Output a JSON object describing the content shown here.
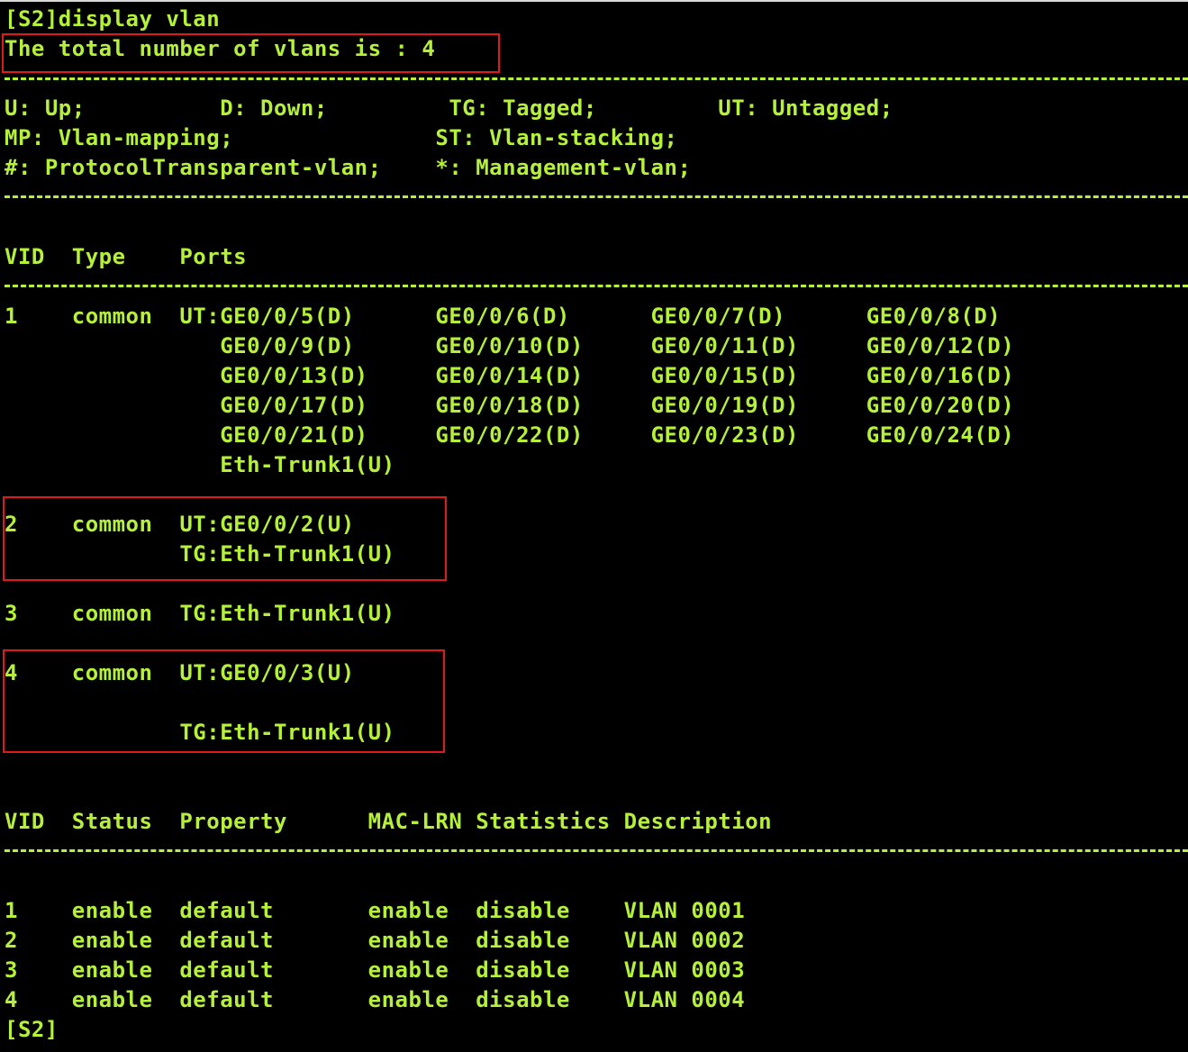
{
  "terminal": {
    "command": "[S2]display vlan",
    "total_line": "The total number of vlans is : 4",
    "legend": [
      "U: Up;          D: Down;         TG: Tagged;         UT: Untagged;",
      "MP: Vlan-mapping;               ST: Vlan-stacking;",
      "#: ProtocolTransparent-vlan;    *: Management-vlan;"
    ],
    "port_header": "VID  Type    Ports",
    "port_rows": [
      "1    common  UT:GE0/0/5(D)      GE0/0/6(D)      GE0/0/7(D)      GE0/0/8(D)",
      "                GE0/0/9(D)      GE0/0/10(D)     GE0/0/11(D)     GE0/0/12(D)",
      "                GE0/0/13(D)     GE0/0/14(D)     GE0/0/15(D)     GE0/0/16(D)",
      "                GE0/0/17(D)     GE0/0/18(D)     GE0/0/19(D)     GE0/0/20(D)",
      "                GE0/0/21(D)     GE0/0/22(D)     GE0/0/23(D)     GE0/0/24(D)",
      "                Eth-Trunk1(U)",
      "2    common  UT:GE0/0/2(U)",
      "             TG:Eth-Trunk1(U)",
      "3    common  TG:Eth-Trunk1(U)",
      "4    common  UT:GE0/0/3(U)",
      "             TG:Eth-Trunk1(U)"
    ],
    "status_header": "VID  Status  Property      MAC-LRN Statistics Description",
    "status_rows": [
      "1    enable  default       enable  disable    VLAN 0001",
      "2    enable  default       enable  disable    VLAN 0002",
      "3    enable  default       enable  disable    VLAN 0003",
      "4    enable  default       enable  disable    VLAN 0004"
    ],
    "prompt": "[S2]"
  },
  "colors": {
    "text": "#b5f13a",
    "background": "#000000",
    "highlight": "#e01a1a"
  }
}
